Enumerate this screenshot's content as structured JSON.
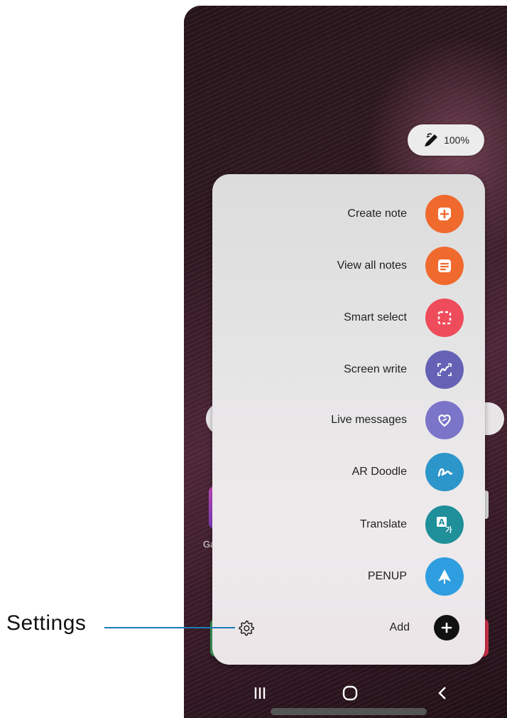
{
  "status": {
    "pen_battery": "100%"
  },
  "home": {
    "app_label_partial": "Ga"
  },
  "air_command": {
    "items": [
      {
        "label": "Create note",
        "icon": "create-note-icon",
        "color": "#f06a2e"
      },
      {
        "label": "View all notes",
        "icon": "notes-list-icon",
        "color": "#f06a2e"
      },
      {
        "label": "Smart select",
        "icon": "smart-select-icon",
        "color": "#ef4c5b"
      },
      {
        "label": "Screen write",
        "icon": "screen-write-icon",
        "color": "#6562b6"
      },
      {
        "label": "Live messages",
        "icon": "heart-icon",
        "color": "#7a75c9"
      },
      {
        "label": "AR Doodle",
        "icon": "ar-doodle-icon",
        "color": "#2c95c9"
      },
      {
        "label": "Translate",
        "icon": "translate-icon",
        "color": "#1f8f9a"
      },
      {
        "label": "PENUP",
        "icon": "penup-icon",
        "color": "#2f9ee0"
      }
    ],
    "add_label": "Add"
  },
  "callout": {
    "settings_label": "Settings"
  },
  "colors": {
    "callout_line": "#1a7db8",
    "panel_bg": "#e6e5e6"
  }
}
